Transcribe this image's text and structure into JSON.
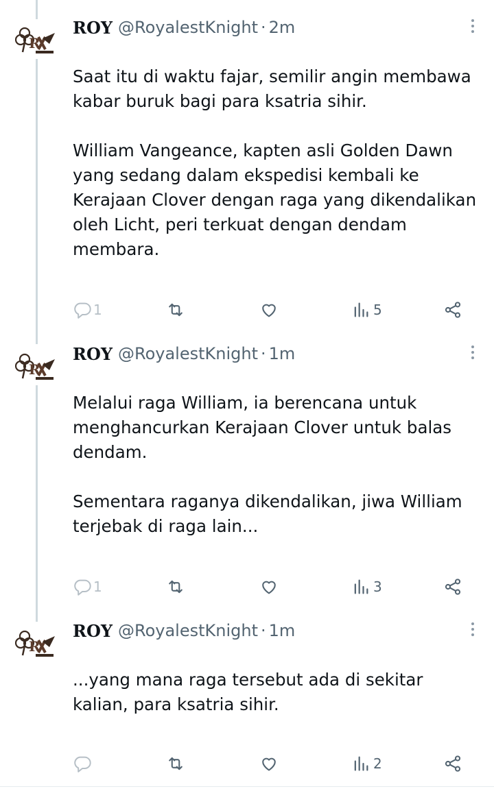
{
  "tweets": [
    {
      "author": {
        "display_name": "ROY",
        "handle": "@RoyalestKnight"
      },
      "separator": "·",
      "time": "2m",
      "paragraphs": [
        "Saat itu di waktu fajar, semilir angin membawa kabar buruk bagi para ksatria sihir.",
        "William Vangeance, kapten asli Golden Dawn yang sedang dalam ekspedisi kembali ke Kerajaan Clover dengan raga yang dikendalikan oleh Licht, peri terkuat dengan dendam membara."
      ],
      "replies": "1",
      "views": "5"
    },
    {
      "author": {
        "display_name": "ROY",
        "handle": "@RoyalestKnight"
      },
      "separator": "·",
      "time": "1m",
      "paragraphs": [
        "Melalui raga William, ia berencana untuk menghancurkan Kerajaan Clover untuk balas dendam.",
        "Sementara raganya dikendalikan, jiwa William terjebak di raga lain..."
      ],
      "replies": "1",
      "views": "3"
    },
    {
      "author": {
        "display_name": "ROY",
        "handle": "@RoyalestKnight"
      },
      "separator": "·",
      "time": "1m",
      "paragraphs": [
        "...yang mana raga tersebut ada di sekitar kalian, para ksatria sihir."
      ],
      "replies": "",
      "views": "2"
    }
  ],
  "icons": {
    "avatar": "roy-logo-avatar",
    "more": "more-vertical-icon",
    "reply": "reply-icon",
    "retweet": "retweet-icon",
    "like": "heart-icon",
    "views": "views-chart-icon",
    "share": "share-icon"
  },
  "colors": {
    "text": "#0f1419",
    "secondary": "#536471",
    "icon": "#8b98a5",
    "thread_line": "#cfd9de"
  }
}
